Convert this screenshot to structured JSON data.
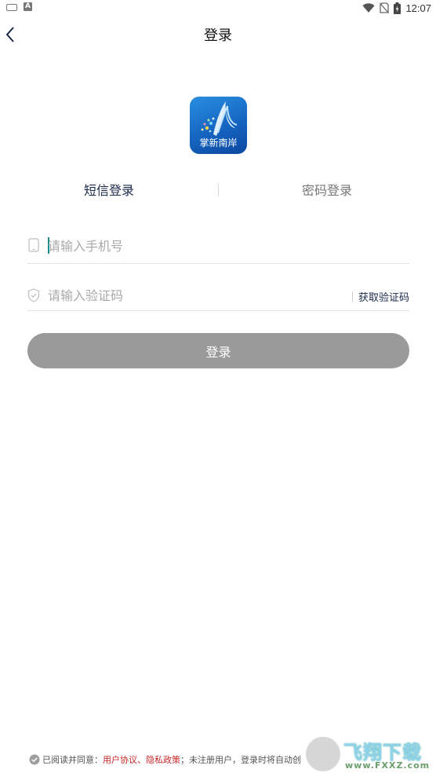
{
  "status_bar": {
    "time": "12:07",
    "notification_letter": "A"
  },
  "header": {
    "title": "登录"
  },
  "logo": {
    "text": "掌新南岸"
  },
  "tabs": [
    {
      "label": "短信登录",
      "active": true
    },
    {
      "label": "密码登录",
      "active": false
    }
  ],
  "phone_field": {
    "placeholder": "请输入手机号",
    "value": ""
  },
  "code_field": {
    "placeholder": "请输入验证码",
    "value": "",
    "get_code_label": "获取验证码"
  },
  "login_button": {
    "label": "登录"
  },
  "agreement": {
    "prefix": "已阅读并同意：",
    "user_agreement": "用户协议",
    "separator": "、",
    "privacy_policy": "隐私政策",
    "suffix": "；未注册用户，登录时将自动创"
  },
  "watermark": {
    "title": "飞翔下载",
    "url": "www.FXXZ.com"
  },
  "colors": {
    "tab_active": "#1b2a4a",
    "tab_inactive": "#777777",
    "button_disabled": "#9a9a9a",
    "link": "#c62828",
    "logo_blue": "#1565c0"
  }
}
